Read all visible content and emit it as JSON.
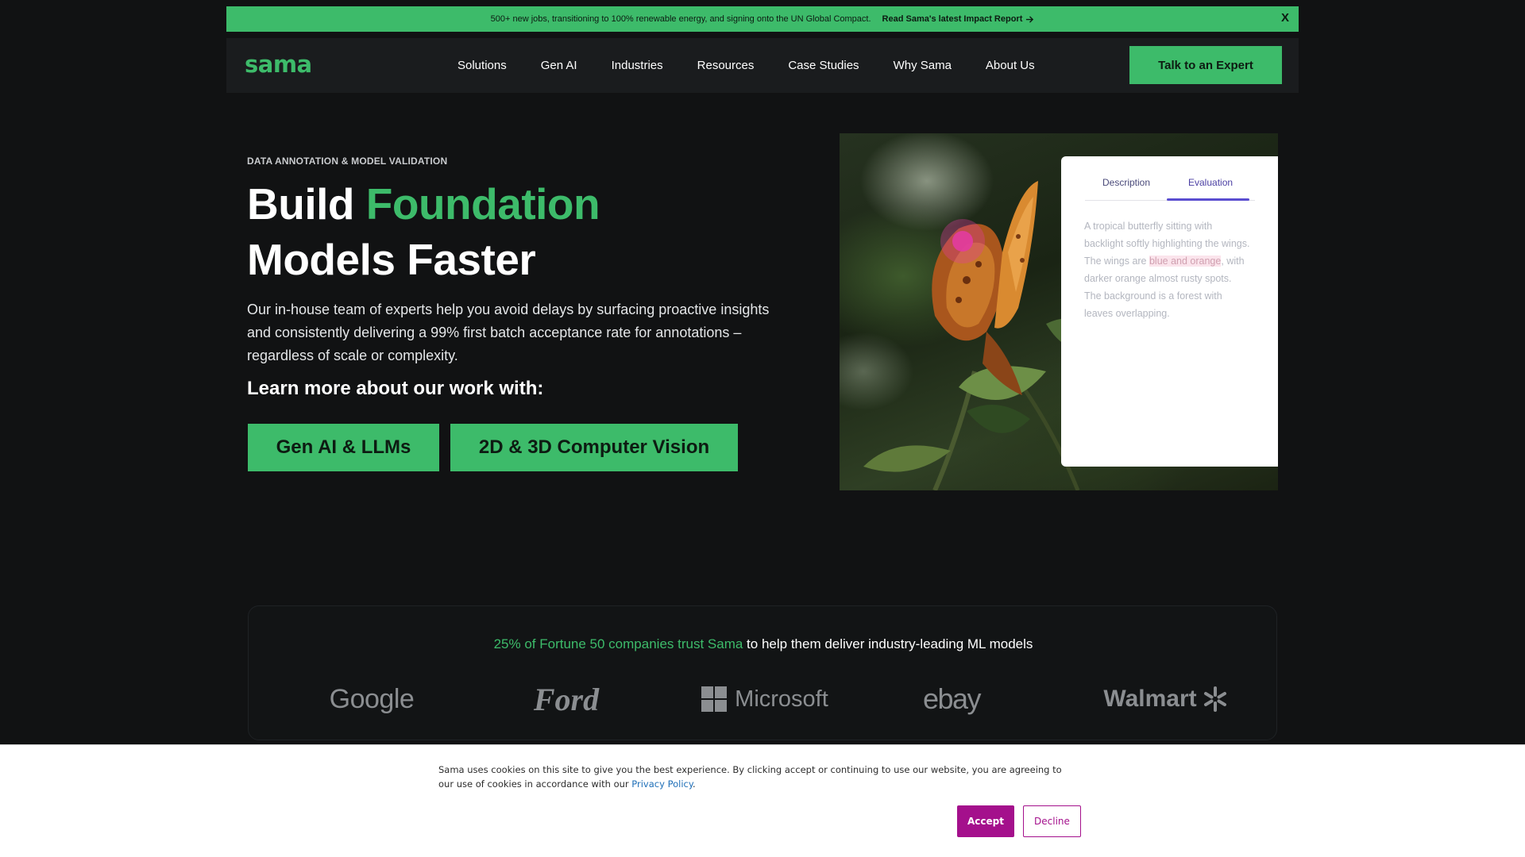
{
  "announcement": {
    "message": "500+ new jobs, transitioning to 100% renewable energy, and signing onto the UN Global Compact.",
    "link_label": "Read Sama's latest Impact Report",
    "link_icon": "arrow-right-icon",
    "close_label": "X",
    "bg_color": "#3dbb6a"
  },
  "nav": {
    "logo": "sama",
    "items": [
      {
        "label": "Solutions"
      },
      {
        "label": "Gen AI"
      },
      {
        "label": "Industries"
      },
      {
        "label": "Resources"
      },
      {
        "label": "Case Studies"
      },
      {
        "label": "Why Sama"
      },
      {
        "label": "About Us"
      }
    ],
    "cta_label": "Talk to an Expert"
  },
  "hero": {
    "eyebrow": "DATA ANNOTATION & MODEL VALIDATION",
    "title_part1": "Build ",
    "title_accent": "Foundation",
    "title_part2": "Models Faster",
    "description": "Our in-house team of experts help you avoid delays by surfacing proactive insights and consistently delivering a 99% first batch acceptance rate for annotations – regardless of scale or complexity.",
    "learn_more": "Learn more about our work with:",
    "buttons": [
      {
        "label": "Gen AI & LLMs"
      },
      {
        "label": "2D & 3D Computer Vision"
      }
    ]
  },
  "annotation_panel": {
    "tabs": [
      {
        "label": "Description"
      },
      {
        "label": "Evaluation",
        "active": true
      }
    ],
    "text_before": "A tropical butterfly sitting with backlight softly highlighting the wings. The wings are ",
    "text_highlight": "blue and orange",
    "text_after": ", with darker orange almost rusty spots. The background is a forest with leaves overlapping."
  },
  "trust": {
    "highlight": "25% of Fortune 50 companies trust Sama",
    "rest": " to help them deliver industry-leading ML models",
    "logos": [
      {
        "name": "Google"
      },
      {
        "name": "Ford"
      },
      {
        "name": "Microsoft"
      },
      {
        "name": "ebay"
      },
      {
        "name": "Walmart"
      }
    ]
  },
  "cookie": {
    "text": "Sama uses cookies on this site to give you the best experience. By clicking accept or continuing to use our website, you are agreeing to our use of cookies in accordance with our ",
    "link": "Privacy Policy",
    "text_end": ".",
    "accept_label": "Accept",
    "decline_label": "Decline",
    "accent_color": "#a4108c"
  },
  "colors": {
    "brand_green": "#3dbb6a",
    "background": "#111213",
    "nav_bg": "#1a1c1e"
  }
}
